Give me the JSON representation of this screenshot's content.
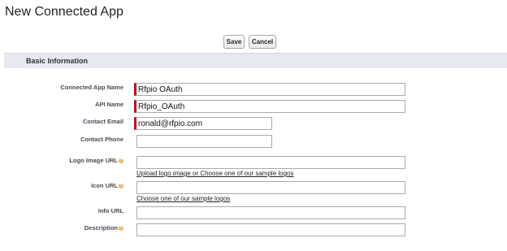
{
  "page": {
    "title": "New Connected App"
  },
  "toolbar": {
    "save_label": "Save",
    "cancel_label": "Cancel"
  },
  "section": {
    "title": "Basic Information"
  },
  "fields": {
    "connected_app_name": {
      "label": "Connected App Name",
      "value": "Rfpio OAuth"
    },
    "api_name": {
      "label": "API Name",
      "value": "Rfpio_OAuth"
    },
    "contact_email": {
      "label": "Contact Email",
      "value": "ronald@rfpio.com"
    },
    "contact_phone": {
      "label": "Contact Phone",
      "value": ""
    },
    "logo_image_url": {
      "label": "Logo Image URL",
      "value": ""
    },
    "icon_url": {
      "label": "Icon URL",
      "value": ""
    },
    "info_url": {
      "label": "Info URL",
      "value": ""
    },
    "description": {
      "label": "Description",
      "value": ""
    }
  },
  "links": {
    "upload_logo": "Upload logo image",
    "or_text": "or",
    "choose_sample_logos": "Choose one of our sample logos",
    "choose_sample_logos_icon": "Choose one of our sample logos"
  },
  "help_icon": {
    "icon": "help-icon",
    "color": "#e7b36a"
  },
  "colors": {
    "required": "#cc0000",
    "section_bg": "#e6e9ee"
  }
}
